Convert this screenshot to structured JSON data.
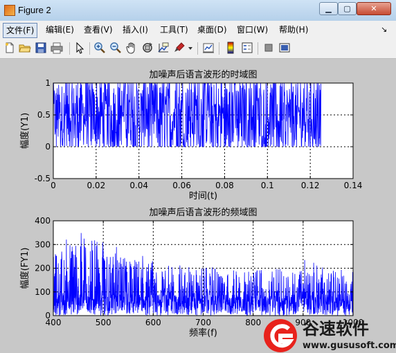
{
  "window": {
    "title": "Figure 2",
    "min_glyph": "▁",
    "max_glyph": "▢",
    "close_glyph": "✕"
  },
  "menu": [
    {
      "id": "file",
      "label": "文件(F)"
    },
    {
      "id": "edit",
      "label": "编辑(E)"
    },
    {
      "id": "view",
      "label": "查看(V)"
    },
    {
      "id": "insert",
      "label": "插入(I)"
    },
    {
      "id": "tools",
      "label": "工具(T)"
    },
    {
      "id": "desktop",
      "label": "桌面(D)"
    },
    {
      "id": "window",
      "label": "窗口(W)"
    },
    {
      "id": "help",
      "label": "帮助(H)"
    }
  ],
  "menu_arrow": "↘",
  "toolbar_icons": [
    "new-figure-icon",
    "open-file-icon",
    "save-icon",
    "print-icon",
    "edit-plot-pointer-icon",
    "zoom-in-icon",
    "zoom-out-icon",
    "pan-hand-icon",
    "rotate-3d-icon",
    "data-cursor-icon",
    "brush-icon",
    "dropdown-arrow-icon",
    "link-plot-icon",
    "insert-colorbar-icon",
    "insert-legend-icon",
    "hide-plot-tools-icon",
    "show-plot-tools-icon"
  ],
  "chart_data": [
    {
      "type": "line",
      "title": "加噪声后语言波形的时域图",
      "xlabel": "时间(t)",
      "ylabel": "幅度(Y1)",
      "xlim": [
        0,
        0.14
      ],
      "ylim": [
        -0.5,
        1
      ],
      "xticks": [
        "0",
        "0.02",
        "0.04",
        "0.06",
        "0.08",
        "0.1",
        "0.12",
        "0.14"
      ],
      "yticks": [
        "-0.5",
        "0",
        "0.5",
        "1"
      ],
      "grid": true,
      "series": [
        {
          "color": "#0000ff",
          "x_range": [
            0,
            0.125
          ],
          "y_range": [
            0,
            1
          ],
          "description_values": "dense noise between 0 and 1"
        }
      ]
    },
    {
      "type": "line",
      "title": "加噪声后语言波形的频域图",
      "xlabel": "频率(f)",
      "ylabel": "幅度(FY1)",
      "xlim": [
        400,
        1000
      ],
      "ylim": [
        0,
        400
      ],
      "xticks": [
        "400",
        "500",
        "600",
        "700",
        "800",
        "900",
        "1000"
      ],
      "yticks": [
        "0",
        "100",
        "200",
        "300",
        "400"
      ],
      "grid": true,
      "series": [
        {
          "color": "#0000ff",
          "x_range": [
            400,
            1000
          ],
          "y_range": [
            0,
            390
          ]
        }
      ]
    }
  ],
  "watermark": {
    "brand": "谷速软件",
    "url": "www.gususoft.com"
  }
}
